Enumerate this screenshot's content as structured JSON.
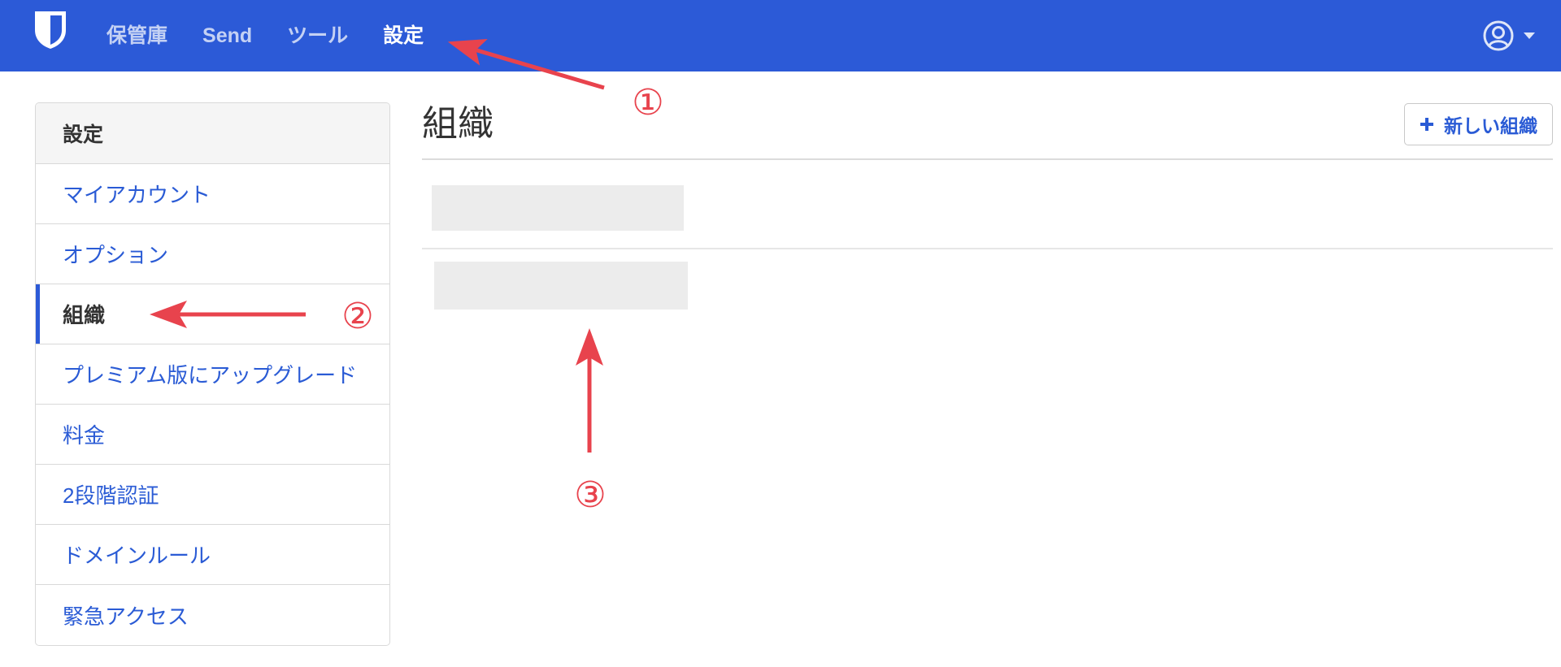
{
  "colors": {
    "navbar_background": "#2c5ad7",
    "link": "#2a5bd5",
    "annotation": "#e8434d",
    "redacted_placeholder": "#ececec"
  },
  "navbar": {
    "logo_icon": "shield-logo-icon",
    "items": [
      {
        "label": "保管庫",
        "active": false
      },
      {
        "label": "Send",
        "active": false
      },
      {
        "label": "ツール",
        "active": false
      },
      {
        "label": "設定",
        "active": true
      }
    ],
    "account": {
      "avatar_icon": "user-circle-icon",
      "caret_icon": "caret-down-icon"
    }
  },
  "sidebar": {
    "header": "設定",
    "items": [
      {
        "label": "マイアカウント",
        "active": false
      },
      {
        "label": "オプション",
        "active": false
      },
      {
        "label": "組織",
        "active": true
      },
      {
        "label": "プレミアム版にアップグレード",
        "active": false
      },
      {
        "label": "料金",
        "active": false
      },
      {
        "label": "2段階認証",
        "active": false
      },
      {
        "label": "ドメインルール",
        "active": false
      },
      {
        "label": "緊急アクセス",
        "active": false
      }
    ]
  },
  "main": {
    "title": "組織",
    "new_organization_button": {
      "icon": "plus-icon",
      "label": "新しい組織"
    }
  },
  "annotations": {
    "markers": [
      "①",
      "②",
      "③"
    ]
  }
}
